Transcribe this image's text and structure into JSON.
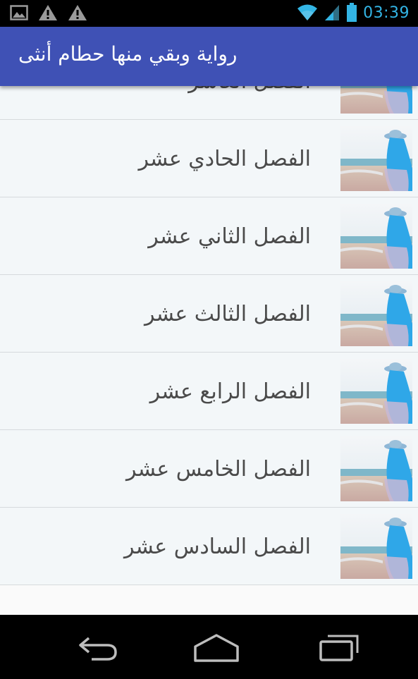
{
  "status_bar": {
    "time": "03:39",
    "icons": [
      "gallery-icon",
      "warning-icon",
      "warning-icon",
      "wifi-icon",
      "signal-icon",
      "battery-icon"
    ],
    "accent_color": "#33b5e5"
  },
  "app_bar": {
    "title": "رواية وبقي منها حطام أنثى",
    "color": "#3f51b5"
  },
  "chapters": [
    {
      "label": "الفصل العاشر"
    },
    {
      "label": "الفصل الحادي عشر"
    },
    {
      "label": "الفصل الثاني عشر"
    },
    {
      "label": "الفصل الثالث عشر"
    },
    {
      "label": "الفصل الرابع عشر"
    },
    {
      "label": "الفصل الخامس عشر"
    },
    {
      "label": "الفصل السادس عشر"
    }
  ],
  "nav_bar": {
    "buttons": [
      "back-icon",
      "home-icon",
      "recent-apps-icon"
    ]
  }
}
